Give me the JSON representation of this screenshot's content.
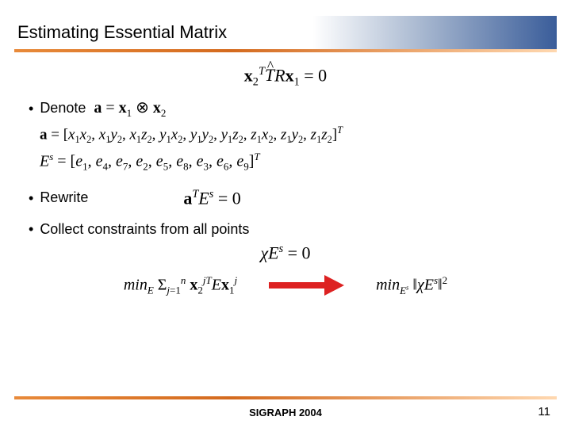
{
  "title": "Estimating Essential Matrix",
  "bullets": {
    "denote": "Denote",
    "rewrite": "Rewrite",
    "collect": "Collect constraints from all points"
  },
  "equations": {
    "top": "x₂ᵀ T̂ R x₁ = 0",
    "denote_inline": "a = x₁ ⊗ x₂",
    "a_vec": "a = [x₁x₂, x₁y₂, x₁z₂, y₁x₂, y₁y₂, y₁z₂, z₁x₂, z₁y₂, z₁z₂]ᵀ",
    "Es_vec": "Eˢ = [e₁, e₄, e₇, e₂, e₅, e₈, e₃, e₆, e₉]ᵀ",
    "rewrite_eq": "aᵀ Eˢ = 0",
    "chi_eq": "χ Eˢ = 0",
    "min_lhs": "min_E Σⱼ₌₁ⁿ x₂ʲᵀ E x₁ʲ",
    "min_rhs": "min_{Eˢ} ‖χ Eˢ‖²"
  },
  "footer": "SIGRAPH 2004",
  "page": "11"
}
